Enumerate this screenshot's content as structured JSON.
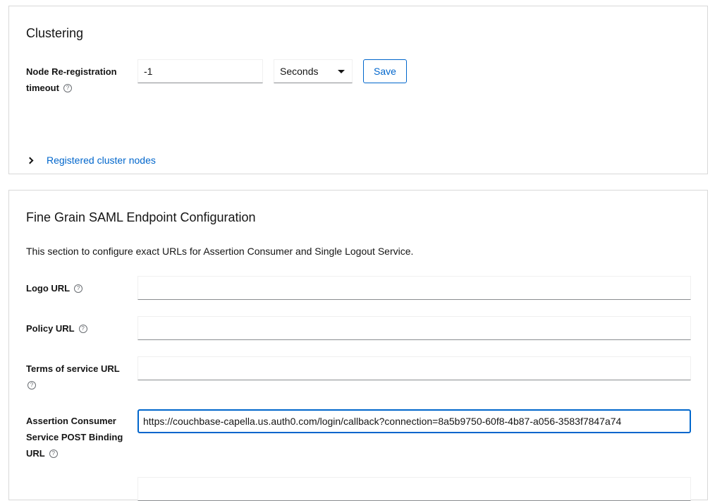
{
  "clustering": {
    "title": "Clustering",
    "node_reregistration": {
      "label": "Node Re-registration timeout",
      "help_icon": "question-circle-icon",
      "value": "-1",
      "unit_selected": "Seconds",
      "save_label": "Save"
    },
    "registered_nodes_label": "Registered cluster nodes"
  },
  "saml": {
    "title": "Fine Grain SAML Endpoint Configuration",
    "description": "This section to configure exact URLs for Assertion Consumer and Single Logout Service.",
    "fields": [
      {
        "label": "Logo URL",
        "value": "",
        "help_icon": "question-circle-icon"
      },
      {
        "label": "Policy URL",
        "value": "",
        "help_icon": "question-circle-icon"
      },
      {
        "label": "Terms of service URL",
        "value": "",
        "help_icon": "question-circle-icon"
      },
      {
        "label": "Assertion Consumer Service POST Binding URL",
        "value": "https://couchbase-capella.us.auth0.com/login/callback?connection=8a5b9750-60f8-4b87-a056-3583f7847a74",
        "help_icon": "question-circle-icon",
        "focused": true
      },
      {
        "label": "",
        "value": ""
      }
    ]
  },
  "colors": {
    "link": "#0066cc",
    "focus_border": "#0066cc",
    "card_border": "#d8d8d8",
    "input_underline": "#8a8d90"
  }
}
